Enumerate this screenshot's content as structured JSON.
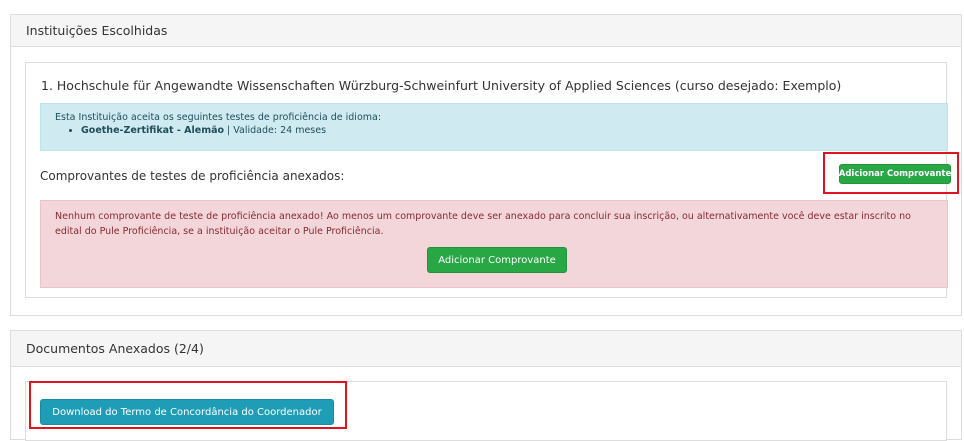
{
  "panel_institutions": {
    "heading": "Instituições Escolhidas",
    "institution_title": "1. Hochschule für Angewandte Wissenschaften Würzburg-Schweinfurt University of Applied Sciences (curso desejado: Exemplo)",
    "info": {
      "intro": "Esta Instituição aceita os seguintes testes de proficiência de idioma:",
      "test_name": "Goethe-Zertifikat - Alemão",
      "separator": " | ",
      "validity": "Validade: 24 meses"
    },
    "attached_label": "Comprovantes de testes de proficiência anexados:",
    "add_button_small": "Adicionar Comprovante",
    "warning_text": "Nenhum comprovante de teste de proficiência anexado! Ao menos um comprovante deve ser anexado para concluir sua inscrição, ou alternativamente você deve estar inscrito no edital do Pule Proficiência, se a instituição aceitar o Pule Proficiência.",
    "add_button_large": "Adicionar Comprovante"
  },
  "panel_documents": {
    "heading": "Documentos Anexados (2/4)",
    "download_button": "Download do Termo de Concordância do Coordenador"
  },
  "colors": {
    "highlight": "#e0141e",
    "success": "#28a745",
    "info_button": "#1f9db7",
    "info_box": "#d0eaf2",
    "danger_box": "#f2d6da"
  }
}
